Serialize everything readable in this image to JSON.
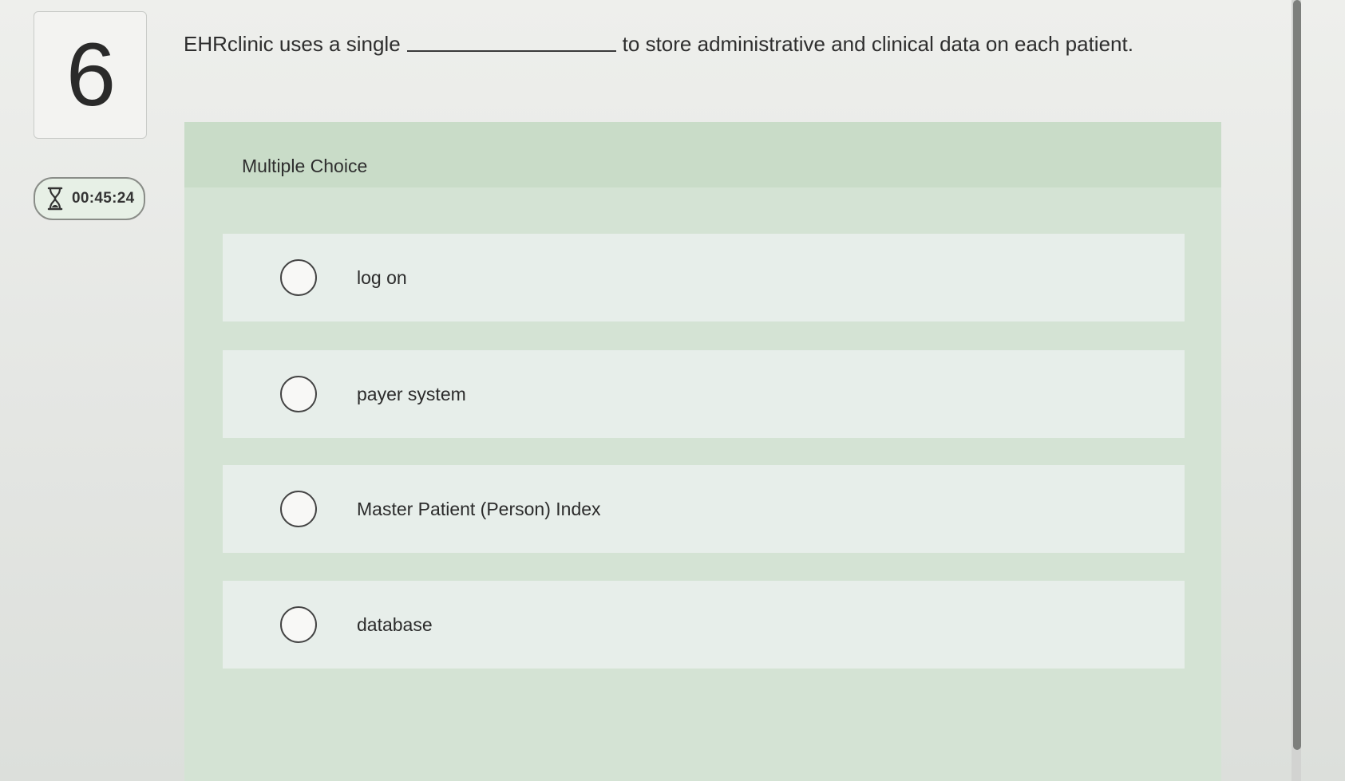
{
  "question_number": "6",
  "timer": {
    "icon": "hourglass-icon",
    "value": "00:45:24"
  },
  "question": {
    "before_blank": "EHRclinic uses a single",
    "after_blank": "to store administrative and clinical data on each patient."
  },
  "panel": {
    "type_label": "Multiple Choice"
  },
  "options": [
    {
      "label": "log on",
      "selected": false
    },
    {
      "label": "payer system",
      "selected": false
    },
    {
      "label": "Master Patient (Person) Index",
      "selected": false
    },
    {
      "label": "database",
      "selected": false
    }
  ],
  "colors": {
    "panel_bg": "#d4e3d4",
    "panel_header": "#c9dcc8",
    "option_bg": "#e7eeea",
    "timer_bg": "#e7f0e6"
  }
}
